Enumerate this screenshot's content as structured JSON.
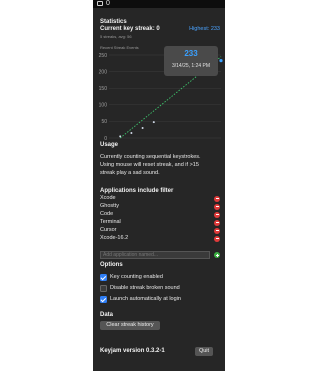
{
  "menubar": {
    "icon": "keyboard-icon",
    "count": "0"
  },
  "stats": {
    "heading": "Statistics",
    "current_streak": "Current key streak: 0",
    "highest": "Highest: 233",
    "summary": "5 streaks, avg: 56",
    "recent_label": "Recent Streak Events"
  },
  "tooltip": {
    "value": "233",
    "date": "3/14/25, 1:24 PM"
  },
  "chart_data": {
    "type": "scatter",
    "title": "Recent Streak Events",
    "y_ticks": [
      "250",
      "200",
      "150",
      "100",
      "50",
      "0"
    ],
    "ylim": [
      0,
      250
    ],
    "trend_line": {
      "style": "dashed",
      "color": "#3ec46d",
      "from": 0,
      "to": 245
    },
    "points": [
      {
        "x": 1,
        "y": 5
      },
      {
        "x": 2,
        "y": 15
      },
      {
        "x": 3,
        "y": 30
      },
      {
        "x": 4,
        "y": 48
      },
      {
        "x": 10,
        "y": 233
      }
    ]
  },
  "usage": {
    "heading": "Usage",
    "lines": [
      "Currently counting sequential keystrokes.",
      "Using mouse will reset streak, and if >15",
      "streak play a sad sound."
    ]
  },
  "apps": {
    "heading": "Applications include filter",
    "items": [
      "Xcode",
      "Ghostty",
      "Code",
      "Terminal",
      "Cursor",
      "Xcode-16.2"
    ],
    "add_placeholder": "Add application named..."
  },
  "options": {
    "heading": "Options",
    "items": [
      {
        "label": "Key counting enabled",
        "checked": true
      },
      {
        "label": "Disable streak broken sound",
        "checked": false
      },
      {
        "label": "Launch automatically at login",
        "checked": true
      }
    ]
  },
  "data_section": {
    "heading": "Data",
    "clear_label": "Clear streak history"
  },
  "footer": {
    "version": "Keyjam version 0.3.2-1",
    "quit_label": "Quit"
  },
  "colors": {
    "accent": "#3aa0ff",
    "panel": "#262626",
    "trend": "#3ec46d",
    "remove": "#e03a3a",
    "add": "#3cb043"
  }
}
